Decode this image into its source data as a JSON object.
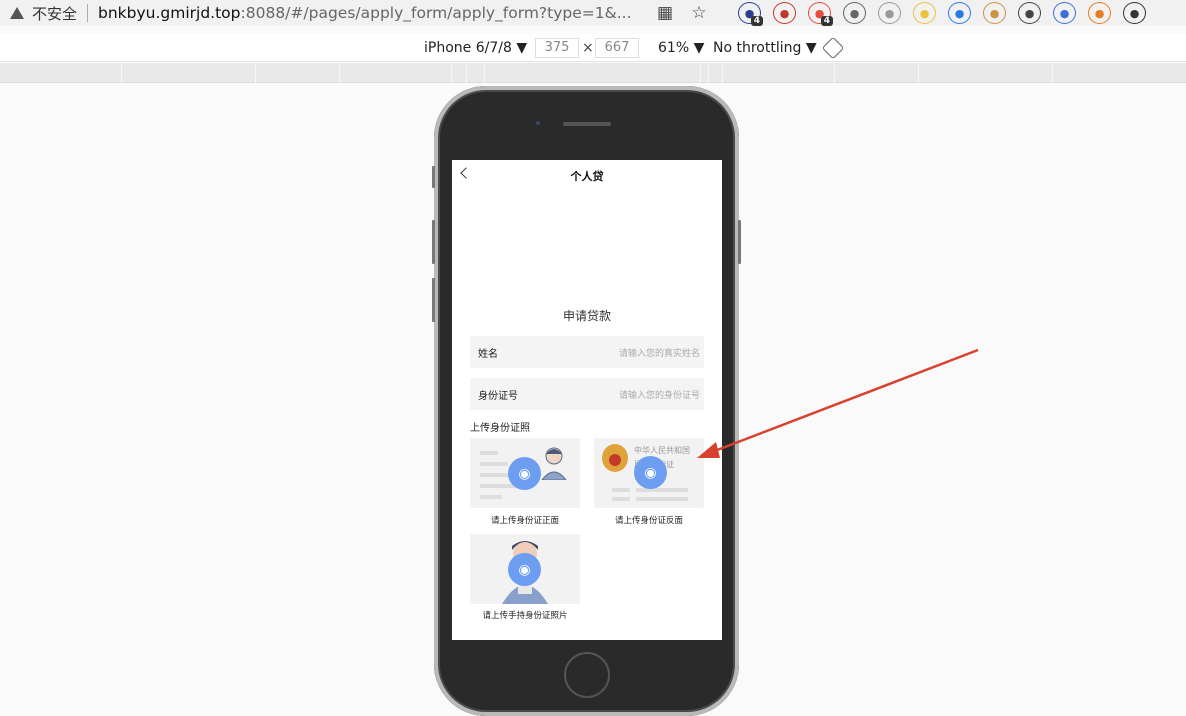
{
  "browser": {
    "security_label": "不安全",
    "url_host": "bnkbyu.gmirjd.top",
    "url_rest": ":8088/#/pages/apply_form/apply_form?type=1&...",
    "extensions": [
      {
        "icon": "graduation-cap-icon",
        "badge": "4",
        "color": "#2c3e8f"
      },
      {
        "icon": "us-flag-icon",
        "badge": "",
        "color": "#c0392b"
      },
      {
        "icon": "link-icon",
        "badge": "4",
        "color": "#e74c3c"
      },
      {
        "icon": "ip-search-icon",
        "badge": "",
        "color": "#666666"
      },
      {
        "icon": "ext-gray-icon",
        "badge": "",
        "color": "#999999"
      },
      {
        "icon": "js-icon",
        "badge": "",
        "color": "#e9c33a"
      },
      {
        "icon": "globe-icon",
        "badge": "",
        "color": "#2a7ae2"
      },
      {
        "icon": "cookie-icon",
        "badge": "",
        "color": "#c99245"
      },
      {
        "icon": "paragraph-icon",
        "badge": "",
        "color": "#444444"
      },
      {
        "icon": "umbrella-icon",
        "badge": "",
        "color": "#3b6fd6"
      },
      {
        "icon": "ip-badge-icon",
        "badge": "",
        "color": "#e67e22"
      },
      {
        "icon": "evernote-icon",
        "badge": "",
        "color": "#333333"
      }
    ]
  },
  "devtools": {
    "device": "iPhone 6/7/8 ▼",
    "width": "375",
    "height": "667",
    "x": "×",
    "zoom": "61% ▼",
    "throttling": "No throttling ▼"
  },
  "app": {
    "nav_title": "个人贷",
    "form_title": "申请贷款",
    "fields": [
      {
        "label": "姓名",
        "placeholder": "请输入您的真实姓名"
      },
      {
        "label": "身份证号",
        "placeholder": "请输入您的身份证号"
      }
    ],
    "upload_title": "上传身份证照",
    "uploads": {
      "front_caption": "请上传身份证正面",
      "back_caption": "请上传身份证反面",
      "hold_caption": "请上传手持身份证照片",
      "back_text_1": "中华人民共和国",
      "back_text_2": "居民身份证"
    }
  },
  "colors": {
    "annotation_arrow": "#d9412f",
    "camera_button": "#6d9df0"
  }
}
